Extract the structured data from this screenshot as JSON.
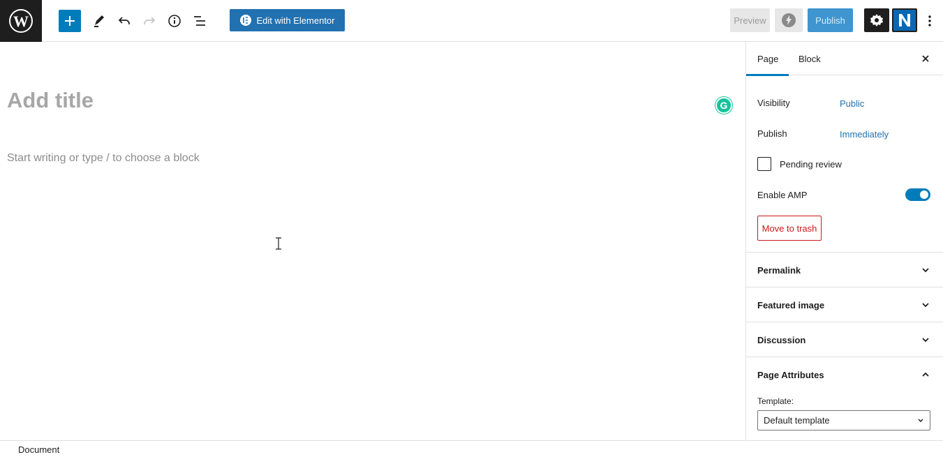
{
  "toolbar": {
    "logo_icon": "wordpress-logo",
    "add_block_icon": "plus-icon",
    "tool_icons": [
      "edit-pencil-icon",
      "undo-icon",
      "redo-icon",
      "info-icon",
      "list-view-icon"
    ],
    "elementor_label": "Edit with Elementor",
    "preview_label": "Preview",
    "publish_label": "Publish",
    "settings_icon": "gear-icon",
    "plugin_icon": "n-plugin-icon",
    "more_icon": "more-vertical-icon"
  },
  "editor": {
    "title_placeholder": "Add title",
    "body_placeholder": "Start writing or type / to choose a block"
  },
  "sidebar": {
    "tabs": [
      {
        "label": "Page",
        "active": true
      },
      {
        "label": "Block",
        "active": false
      }
    ],
    "visibility_label": "Visibility",
    "visibility_value": "Public",
    "publish_label": "Publish",
    "publish_value": "Immediately",
    "pending_review_label": "Pending review",
    "pending_review_checked": false,
    "amp_label": "Enable AMP",
    "amp_enabled": true,
    "trash_label": "Move to trash",
    "panels": [
      {
        "title": "Permalink",
        "expanded": false
      },
      {
        "title": "Featured image",
        "expanded": false
      },
      {
        "title": "Discussion",
        "expanded": false
      },
      {
        "title": "Page Attributes",
        "expanded": true
      }
    ],
    "template_label": "Template:",
    "template_value": "Default template"
  },
  "footer": {
    "breadcrumb": "Document"
  },
  "colors": {
    "accent": "#007cba",
    "elementor": "#2271b1",
    "danger": "#cc1818",
    "grammarly": "#15c39a"
  }
}
